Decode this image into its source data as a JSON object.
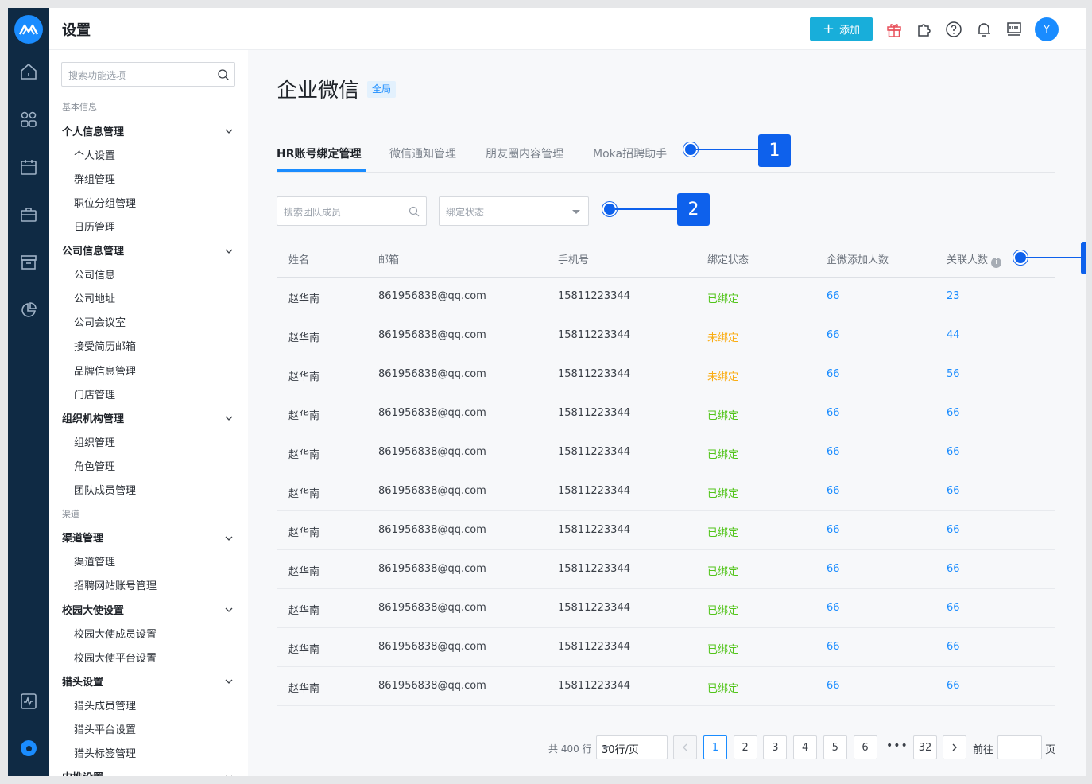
{
  "header": {
    "title": "设置",
    "add_label": "添加",
    "avatar_initial": "Y"
  },
  "sidebar": {
    "search_placeholder": "搜索功能选项",
    "rows": [
      {
        "type": "cat",
        "label": "基本信息"
      },
      {
        "type": "grp",
        "label": "个人信息管理"
      },
      {
        "type": "itm",
        "label": "个人设置"
      },
      {
        "type": "itm",
        "label": "群组管理"
      },
      {
        "type": "itm",
        "label": "职位分组管理"
      },
      {
        "type": "itm",
        "label": "日历管理"
      },
      {
        "type": "grp",
        "label": "公司信息管理"
      },
      {
        "type": "itm",
        "label": "公司信息"
      },
      {
        "type": "itm",
        "label": "公司地址"
      },
      {
        "type": "itm",
        "label": "公司会议室"
      },
      {
        "type": "itm",
        "label": "接受简历邮箱"
      },
      {
        "type": "itm",
        "label": "品牌信息管理"
      },
      {
        "type": "itm",
        "label": "门店管理"
      },
      {
        "type": "grp",
        "label": "组织机构管理"
      },
      {
        "type": "itm",
        "label": "组织管理"
      },
      {
        "type": "itm",
        "label": "角色管理"
      },
      {
        "type": "itm",
        "label": "团队成员管理"
      },
      {
        "type": "cat",
        "label": "渠道"
      },
      {
        "type": "grp",
        "label": "渠道管理"
      },
      {
        "type": "itm",
        "label": "渠道管理"
      },
      {
        "type": "itm",
        "label": "招聘网站账号管理"
      },
      {
        "type": "grp",
        "label": "校园大使设置"
      },
      {
        "type": "itm",
        "label": "校园大使成员设置"
      },
      {
        "type": "itm",
        "label": "校园大使平台设置"
      },
      {
        "type": "grp",
        "label": "猎头设置"
      },
      {
        "type": "itm",
        "label": "猎头成员管理"
      },
      {
        "type": "itm",
        "label": "猎头平台设置"
      },
      {
        "type": "itm",
        "label": "猎头标签管理"
      },
      {
        "type": "grp",
        "label": "内推设置"
      }
    ]
  },
  "main": {
    "title": "企业微信",
    "tag": "全局",
    "tabs": [
      "HR账号绑定管理",
      "微信通知管理",
      "朋友圈内容管理",
      "Moka招聘助手"
    ],
    "search_placeholder": "搜索团队成员",
    "status_placeholder": "绑定状态",
    "callouts": [
      "1",
      "2"
    ]
  },
  "table": {
    "columns": [
      "姓名",
      "邮箱",
      "手机号",
      "绑定状态",
      "企微添加人数",
      "关联人数"
    ],
    "rows": [
      {
        "name": "赵华南",
        "email": "861956838@qq.com",
        "phone": "15811223344",
        "status": "已绑定",
        "added": "66",
        "linked": "23"
      },
      {
        "name": "赵华南",
        "email": "861956838@qq.com",
        "phone": "15811223344",
        "status": "未绑定",
        "added": "66",
        "linked": "44"
      },
      {
        "name": "赵华南",
        "email": "861956838@qq.com",
        "phone": "15811223344",
        "status": "未绑定",
        "added": "66",
        "linked": "56"
      },
      {
        "name": "赵华南",
        "email": "861956838@qq.com",
        "phone": "15811223344",
        "status": "已绑定",
        "added": "66",
        "linked": "66"
      },
      {
        "name": "赵华南",
        "email": "861956838@qq.com",
        "phone": "15811223344",
        "status": "已绑定",
        "added": "66",
        "linked": "66"
      },
      {
        "name": "赵华南",
        "email": "861956838@qq.com",
        "phone": "15811223344",
        "status": "已绑定",
        "added": "66",
        "linked": "66"
      },
      {
        "name": "赵华南",
        "email": "861956838@qq.com",
        "phone": "15811223344",
        "status": "已绑定",
        "added": "66",
        "linked": "66"
      },
      {
        "name": "赵华南",
        "email": "861956838@qq.com",
        "phone": "15811223344",
        "status": "已绑定",
        "added": "66",
        "linked": "66"
      },
      {
        "name": "赵华南",
        "email": "861956838@qq.com",
        "phone": "15811223344",
        "status": "已绑定",
        "added": "66",
        "linked": "66"
      },
      {
        "name": "赵华南",
        "email": "861956838@qq.com",
        "phone": "15811223344",
        "status": "已绑定",
        "added": "66",
        "linked": "66"
      },
      {
        "name": "赵华南",
        "email": "861956838@qq.com",
        "phone": "15811223344",
        "status": "已绑定",
        "added": "66",
        "linked": "66"
      }
    ]
  },
  "pagination": {
    "total": "共 400 行",
    "page_size": "30行/页",
    "pages": [
      "1",
      "2",
      "3",
      "4",
      "5",
      "6"
    ],
    "ellipsis": "•••",
    "last_page": "32",
    "goto_label": "前往",
    "page_unit": "页",
    "current": "1"
  },
  "colors": {
    "rail": "#0f2a44",
    "accent": "#1a8cff",
    "add_button": "#18aeda",
    "callout": "#0e61ec",
    "bound": "#52c41a",
    "unbound": "#faad14"
  }
}
